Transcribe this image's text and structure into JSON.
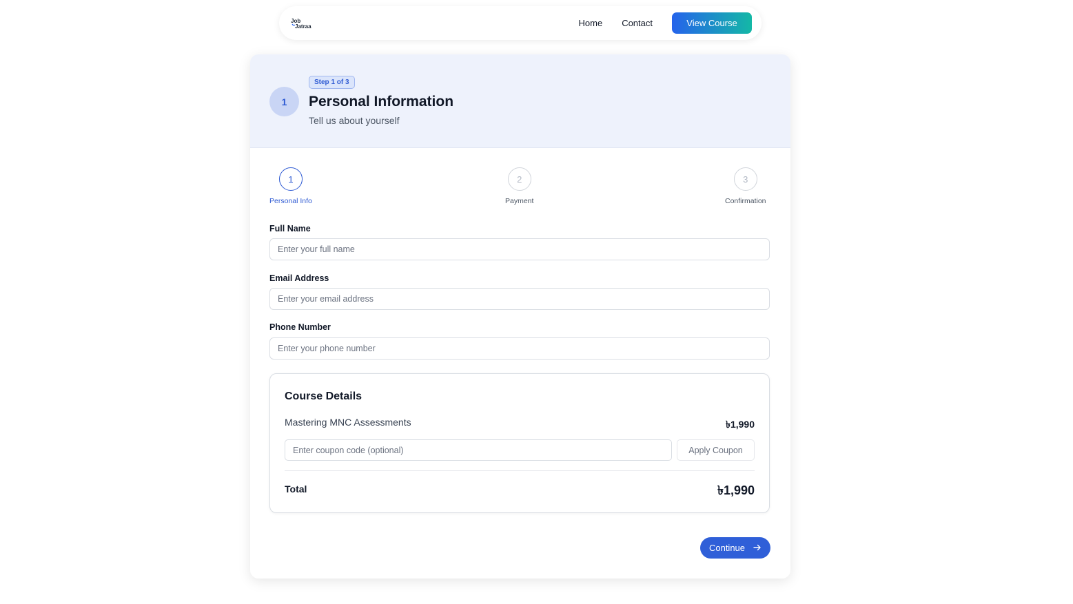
{
  "nav": {
    "logo_line1": "Job",
    "logo_line2": "Jatraa",
    "links": [
      "Home",
      "Contact"
    ],
    "cta": "View Course"
  },
  "header": {
    "step_number": "1",
    "badge": "Step 1 of 3",
    "title": "Personal Information",
    "subtitle": "Tell us about yourself"
  },
  "stepper": [
    {
      "number": "1",
      "label": "Personal Info",
      "active": true
    },
    {
      "number": "2",
      "label": "Payment",
      "active": false
    },
    {
      "number": "3",
      "label": "Confirmation",
      "active": false
    }
  ],
  "form": {
    "full_name": {
      "label": "Full Name",
      "placeholder": "Enter your full name",
      "value": ""
    },
    "email": {
      "label": "Email Address",
      "placeholder": "Enter your email address",
      "value": ""
    },
    "phone": {
      "label": "Phone Number",
      "placeholder": "Enter your phone number",
      "value": ""
    }
  },
  "course": {
    "title": "Course Details",
    "name": "Mastering MNC Assessments",
    "price": "৳1,990",
    "coupon_placeholder": "Enter coupon code (optional)",
    "apply_label": "Apply Coupon",
    "total_label": "Total",
    "total_value": "৳1,990"
  },
  "actions": {
    "continue_label": "Continue",
    "continue_icon": "arrow-right-icon"
  },
  "colors": {
    "primary": "#2f5fd8",
    "cta_gradient_start": "#2563eb",
    "cta_gradient_end": "#14b8a6",
    "header_bg": "#eef2fc"
  }
}
